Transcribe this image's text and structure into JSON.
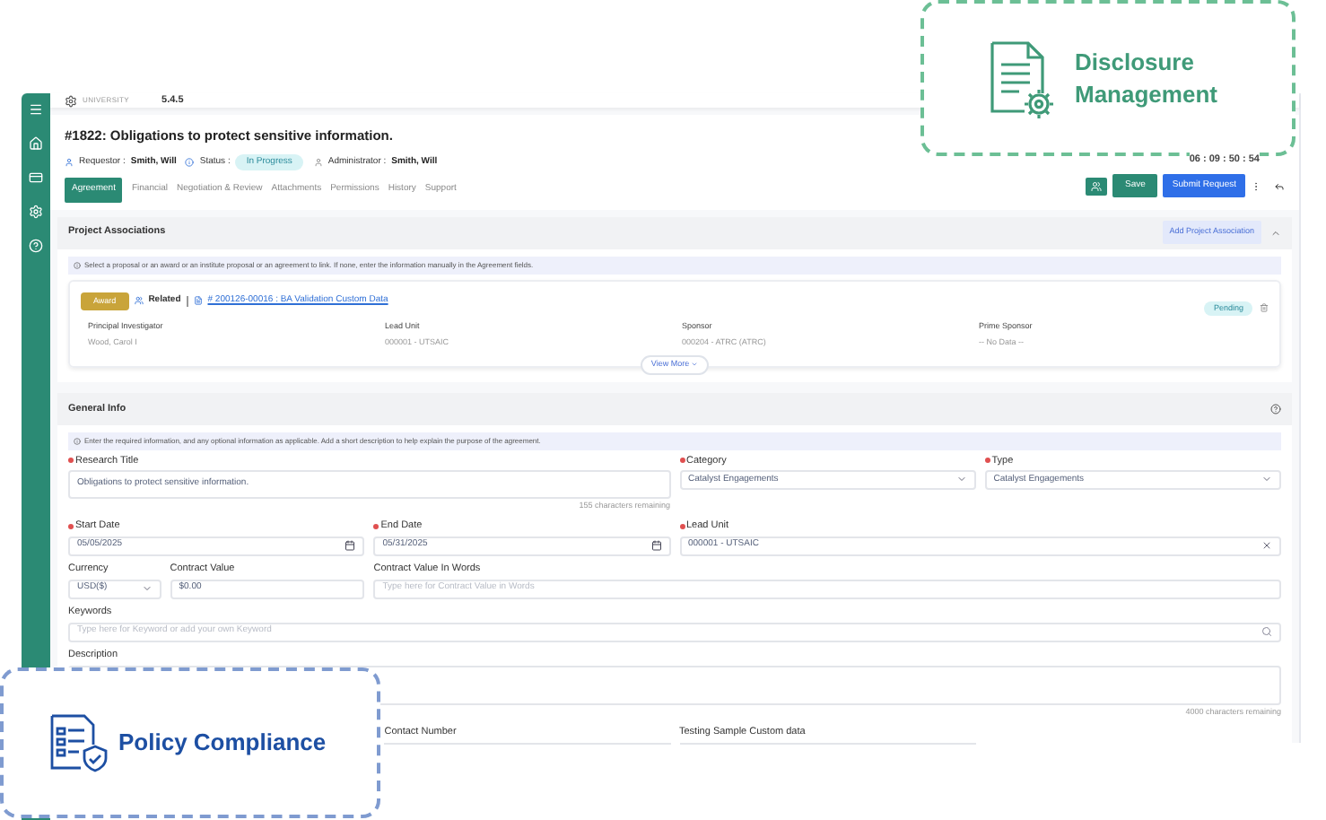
{
  "header": {
    "logo_text": "UNIVERSITY",
    "version": "5.4.5"
  },
  "record": {
    "title": "#1822: Obligations to protect sensitive information.",
    "requestor_label": "Requestor :",
    "requestor": "Smith, Will",
    "status_label": "Status :",
    "status": "In Progress",
    "admin_label": "Administrator :",
    "admin": "Smith, Will",
    "timer": "06 : 09 : 50 : 54"
  },
  "tabs": [
    {
      "label": "Agreement",
      "selected": true
    },
    {
      "label": "Financial",
      "selected": false
    },
    {
      "label": "Negotiation & Review",
      "selected": false
    },
    {
      "label": "Attachments",
      "selected": false
    },
    {
      "label": "Permissions",
      "selected": false
    },
    {
      "label": "History",
      "selected": false
    },
    {
      "label": "Support",
      "selected": false
    }
  ],
  "actions": {
    "save": "Save",
    "submit": "Submit Request"
  },
  "project_associations": {
    "title": "Project Associations",
    "add_button": "Add Project Association",
    "expanded": true,
    "info": "Select a proposal or an award or an institute proposal or an agreement to link. If none, enter the information manually in the Agreement fields.",
    "card": {
      "badge": "Award",
      "related_label": "Related",
      "link": "# 200126-00016 : BA Validation Custom Data",
      "status": "Pending",
      "view_more": "View More",
      "fields": [
        {
          "label": "Principal Investigator",
          "value": "Wood, Carol I"
        },
        {
          "label": "Lead Unit",
          "value": "000001 - UTSAIC"
        },
        {
          "label": "Sponsor",
          "value": "000204 - ATRC (ATRC)"
        },
        {
          "label": "Prime Sponsor",
          "value": "-- No Data --"
        }
      ]
    }
  },
  "general_info": {
    "title": "General Info",
    "info": "Enter the required information, and any optional information as applicable. Add a short description to help explain the purpose of the agreement.",
    "rows": [
      {
        "fields": [
          {
            "kind": "textarea",
            "label": "Research Title",
            "required": true,
            "value": "Obligations to protect sensitive information.",
            "hint": "155 characters remaining"
          },
          {
            "kind": "select",
            "label": "Category",
            "required": true,
            "value": "Catalyst Engagements"
          },
          {
            "kind": "select",
            "label": "Type",
            "required": true,
            "value": "Catalyst Engagements"
          }
        ]
      },
      {
        "fields": [
          {
            "kind": "date",
            "label": "Start Date",
            "required": true,
            "value": "05/05/2025"
          },
          {
            "kind": "date",
            "label": "End Date",
            "required": true,
            "value": "05/31/2025"
          },
          {
            "kind": "clear",
            "label": "Lead Unit",
            "required": true,
            "value": "000001 - UTSAIC"
          }
        ]
      },
      {
        "fields": [
          {
            "kind": "select",
            "label": "Currency",
            "required": false,
            "value": "USD($)"
          },
          {
            "kind": "text",
            "label": "Contract Value",
            "required": false,
            "value": "$0.00"
          },
          {
            "kind": "text",
            "label": "Contract Value In Words",
            "required": false,
            "placeholder": "Type here for Contract Value in Words"
          }
        ]
      },
      {
        "fields": [
          {
            "kind": "search",
            "label": "Keywords",
            "required": false,
            "placeholder": "Type here for Keyword or add your own Keyword"
          }
        ]
      },
      {
        "fields": [
          {
            "kind": "textarea",
            "label": "Description",
            "required": false,
            "hint": "4000 characters remaining"
          }
        ]
      },
      {
        "fields": [
          {
            "kind": "label",
            "label": "Contact Number",
            "required": false
          },
          {
            "kind": "label",
            "label": "Testing Sample Custom data",
            "required": false
          }
        ]
      }
    ]
  },
  "callouts": [
    {
      "kind": "disclosure",
      "text": "Disclosure Management"
    },
    {
      "kind": "policy",
      "text": "Policy Compliance"
    }
  ]
}
